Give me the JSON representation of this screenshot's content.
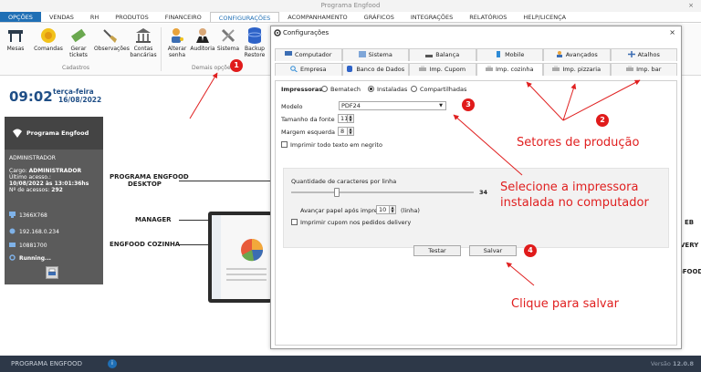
{
  "window": {
    "title": "Programa Engfood",
    "close": "×"
  },
  "menu": [
    "OPÇÕES",
    "VENDAS",
    "RH",
    "PRODUTOS",
    "FINANCEIRO",
    "CONFIGURAÇÕES",
    "ACOMPANHAMENTO",
    "GRÁFICOS",
    "INTEGRAÇÕES",
    "RELATÓRIOS",
    "HELP/LICENÇA"
  ],
  "ribbon": {
    "buttons": [
      "Mesas",
      "Comandas",
      "Gerar tickets",
      "Observações",
      "Contas bancárias",
      "Alterar senha",
      "Auditoria",
      "Sistema",
      "Backup Restore"
    ],
    "group_cadastros": "Cadastros",
    "group_demais": "Demais opções"
  },
  "left": {
    "time": "09:02",
    "weekday": "terça-feira",
    "date": "16/08/2022",
    "brand": "Programa Engfood",
    "user": "ADMINISTRADOR",
    "cargo_label": "Cargo:",
    "cargo": "ADMINISTRADOR",
    "last_access_label": "Último acesso.:",
    "last_access": "10/08/2022 às 13:01:36hs",
    "access_count_label": "Nº de acessos:",
    "access_count": "292",
    "resolution": "1366X768",
    "ip": "192.168.0.234",
    "serial": "10881700",
    "status": "Running..."
  },
  "background_labels": {
    "desktop_line1": "PROGRAMA ENGFOOD",
    "desktop_line2": "DESKTOP",
    "manager": "MANAGER",
    "cozinha": "ENGFOOD COZINHA",
    "right1": "EB",
    "right2": "VERY",
    "right3": "GFOOD"
  },
  "bottom": {
    "name": "PROGRAMA ENGFOOD",
    "version_label": "Versão",
    "version": "12.0.8"
  },
  "dialog": {
    "title": "Configurações",
    "close": "×",
    "tabs_row1": [
      "Computador",
      "Sistema",
      "Balança",
      "Mobile",
      "Avançados",
      "Atalhos"
    ],
    "tabs_row2": [
      "Empresa",
      "Banco de Dados",
      "Imp. Cupom",
      "Imp. cozinha",
      "Imp. pizzaria",
      "Imp. bar"
    ],
    "active_tab": "Imp. cozinha",
    "printers_label": "Impressoras",
    "radio_options": [
      "Bematech",
      "Instaladas",
      "Compartilhadas"
    ],
    "radio_selected": "Instaladas",
    "model_label": "Modelo",
    "model_value": "PDF24",
    "font_size_label": "Tamanho da fonte",
    "font_size_value": "11",
    "left_margin_label": "Margem esquerda",
    "left_margin_value": "8",
    "bold_label": "Imprimir todo texto em negrito",
    "chars_label": "Quantidade de caracteres por linha",
    "chars_value": "34",
    "chars_fraction": 0.25,
    "advance_label": "Avançar papel após impressão",
    "advance_value": "10",
    "advance_unit": "(linha)",
    "delivery_label": "Imprimir cupom nos pedidos delivery",
    "test_button": "Testar",
    "save_button": "Salvar"
  },
  "annotations": {
    "badges": [
      "1",
      "2",
      "3",
      "4"
    ],
    "text2": "Setores de produção",
    "text3_line1": "Selecione a impressora",
    "text3_line2": "instalada no computador",
    "text4": "Clique para salvar"
  },
  "colors": {
    "accent": "#1f6fb5",
    "annotation": "#e02020",
    "bottom_bar": "#2d3848",
    "panel": "#5b5b5b"
  }
}
